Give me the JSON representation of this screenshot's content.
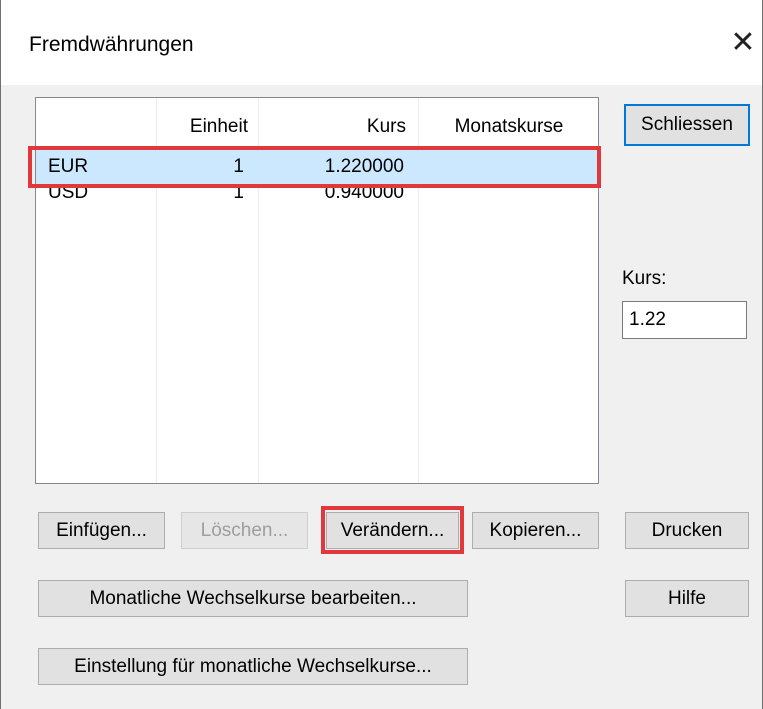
{
  "window": {
    "title": "Fremdwährungen",
    "close_glyph": "✕"
  },
  "list": {
    "columns": [
      "",
      "Einheit",
      "Kurs",
      "Monatskurse"
    ],
    "rows": [
      {
        "currency": "EUR",
        "unit": "1",
        "rate": "1.220000",
        "monthly": "",
        "selected": true
      },
      {
        "currency": "USD",
        "unit": "1",
        "rate": "0.940000",
        "monthly": "",
        "selected": false
      }
    ]
  },
  "buttons": {
    "close": "Schliessen",
    "insert": "Einfügen...",
    "delete": "Löschen...",
    "change": "Verändern...",
    "copy": "Kopieren...",
    "print": "Drucken",
    "monthly_edit": "Monatliche Wechselkurse bearbeiten...",
    "help": "Hilfe",
    "monthly_settings": "Einstellung für monatliche Wechselkurse..."
  },
  "rate_field": {
    "label": "Kurs:",
    "value": "1.22"
  },
  "colors": {
    "selection": "#cce8ff",
    "highlight": "#e0383b",
    "default_button_border": "#0078d7"
  }
}
